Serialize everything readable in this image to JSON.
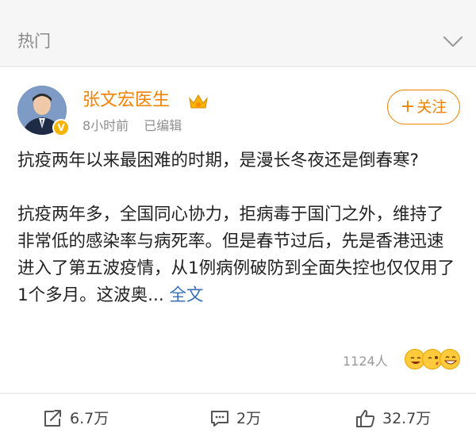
{
  "header": {
    "section_title": "热门"
  },
  "post": {
    "author": "张文宏医生",
    "time": "8小时前",
    "edited": "已编辑",
    "follow_label": "关注",
    "title_line": "抗疫两年以来最困难的时期，是漫长冬夜还是倒春寒?",
    "body": "抗疫两年多，全国同心协力，拒病毒于国门之外，维持了非常低的感染率与病死率。但是春节过后，先是香港迅速进入了第五波疫情，从1例病例破防到全面失控也仅仅用了1个多月。这波奥...",
    "more_label": "全文",
    "reaction_count": "1124人"
  },
  "actions": {
    "repost": "6.7万",
    "comment": "2万",
    "like": "32.7万"
  },
  "colors": {
    "accent": "#f08200",
    "link": "#3a6fb6"
  },
  "icons": {
    "collapse": "chevron-down-icon",
    "repost": "share-icon",
    "comment": "comment-icon",
    "like": "thumbs-up-icon"
  }
}
